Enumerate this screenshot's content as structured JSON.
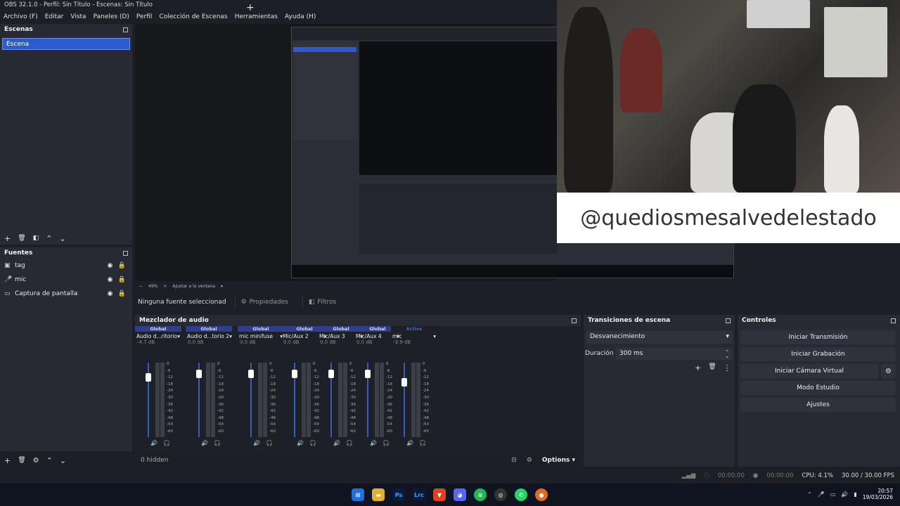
{
  "window": {
    "title": "OBS 32.1.0 - Perfil: Sin Título - Escenas: Sin Título"
  },
  "menu": [
    "Archivo (F)",
    "Editar",
    "Vista",
    "Paneles (D)",
    "Perfil",
    "Colección de Escenas",
    "Herramientas",
    "Ayuda (H)"
  ],
  "scenes": {
    "title": "Escenas",
    "items": [
      "Escena"
    ]
  },
  "sources": {
    "title": "Fuentes",
    "items": [
      {
        "label": "tag",
        "icon": "text-icon"
      },
      {
        "label": "mic",
        "icon": "microphone-icon"
      },
      {
        "label": "Captura de pantalla",
        "icon": "monitor-icon"
      }
    ]
  },
  "overlay": {
    "tag_text": "@quediosmesalvedelestado"
  },
  "preview_status": {
    "zoom": "49%",
    "fit": "Ajustar a la ventana"
  },
  "context_bar": {
    "no_source": "Ninguna fuente seleccionad",
    "properties": "Propiedades",
    "filters": "Filtros"
  },
  "mixer": {
    "title": "Mezclador de audio",
    "channels": [
      {
        "badge": "Global",
        "name": "Audio d...ritorio",
        "db": "-4.7 dB",
        "level": 0.85
      },
      {
        "badge": "Global",
        "name": "Audio d...torio 2",
        "db": "0.0 dB",
        "level": 0.9
      },
      {
        "badge": "Global",
        "name": "mic minifuse",
        "db": "0.0 dB",
        "level": 0.9
      },
      {
        "badge": "Global",
        "name": "Mic/Aux 2",
        "db": "0.0 dB",
        "level": 0.9
      },
      {
        "badge": "Global",
        "name": "Mic/Aux 3",
        "db": "0.0 dB",
        "level": 0.9
      },
      {
        "badge": "Global",
        "name": "Mic/Aux 4",
        "db": "0.0 dB",
        "level": 0.9
      },
      {
        "badge": "Active",
        "name": "mic",
        "db": "-3.9 dB",
        "level": 0.78
      }
    ],
    "scale": [
      "0",
      "-6",
      "-12",
      "-18",
      "-24",
      "-30",
      "-36",
      "-42",
      "-48",
      "-54",
      "-60"
    ],
    "hidden": "0 hidden",
    "options": "Options"
  },
  "transitions": {
    "title": "Transiciones de escena",
    "selected": "Desvanecimiento",
    "duration_label": "Duración",
    "duration_value": "300 ms"
  },
  "controls": {
    "title": "Controles",
    "buttons": [
      "Iniciar Transmisión",
      "Iniciar Grabación",
      "Iniciar Cámara Virtual",
      "Modo Estudio",
      "Ajustes"
    ]
  },
  "status": {
    "rec_time": "00:00:00",
    "stream_time": "00:00:00",
    "cpu": "CPU: 4.1%",
    "fps": "30.00 / 30.00 FPS"
  },
  "taskbar": {
    "time": "20:57",
    "date": "19/03/2026"
  }
}
